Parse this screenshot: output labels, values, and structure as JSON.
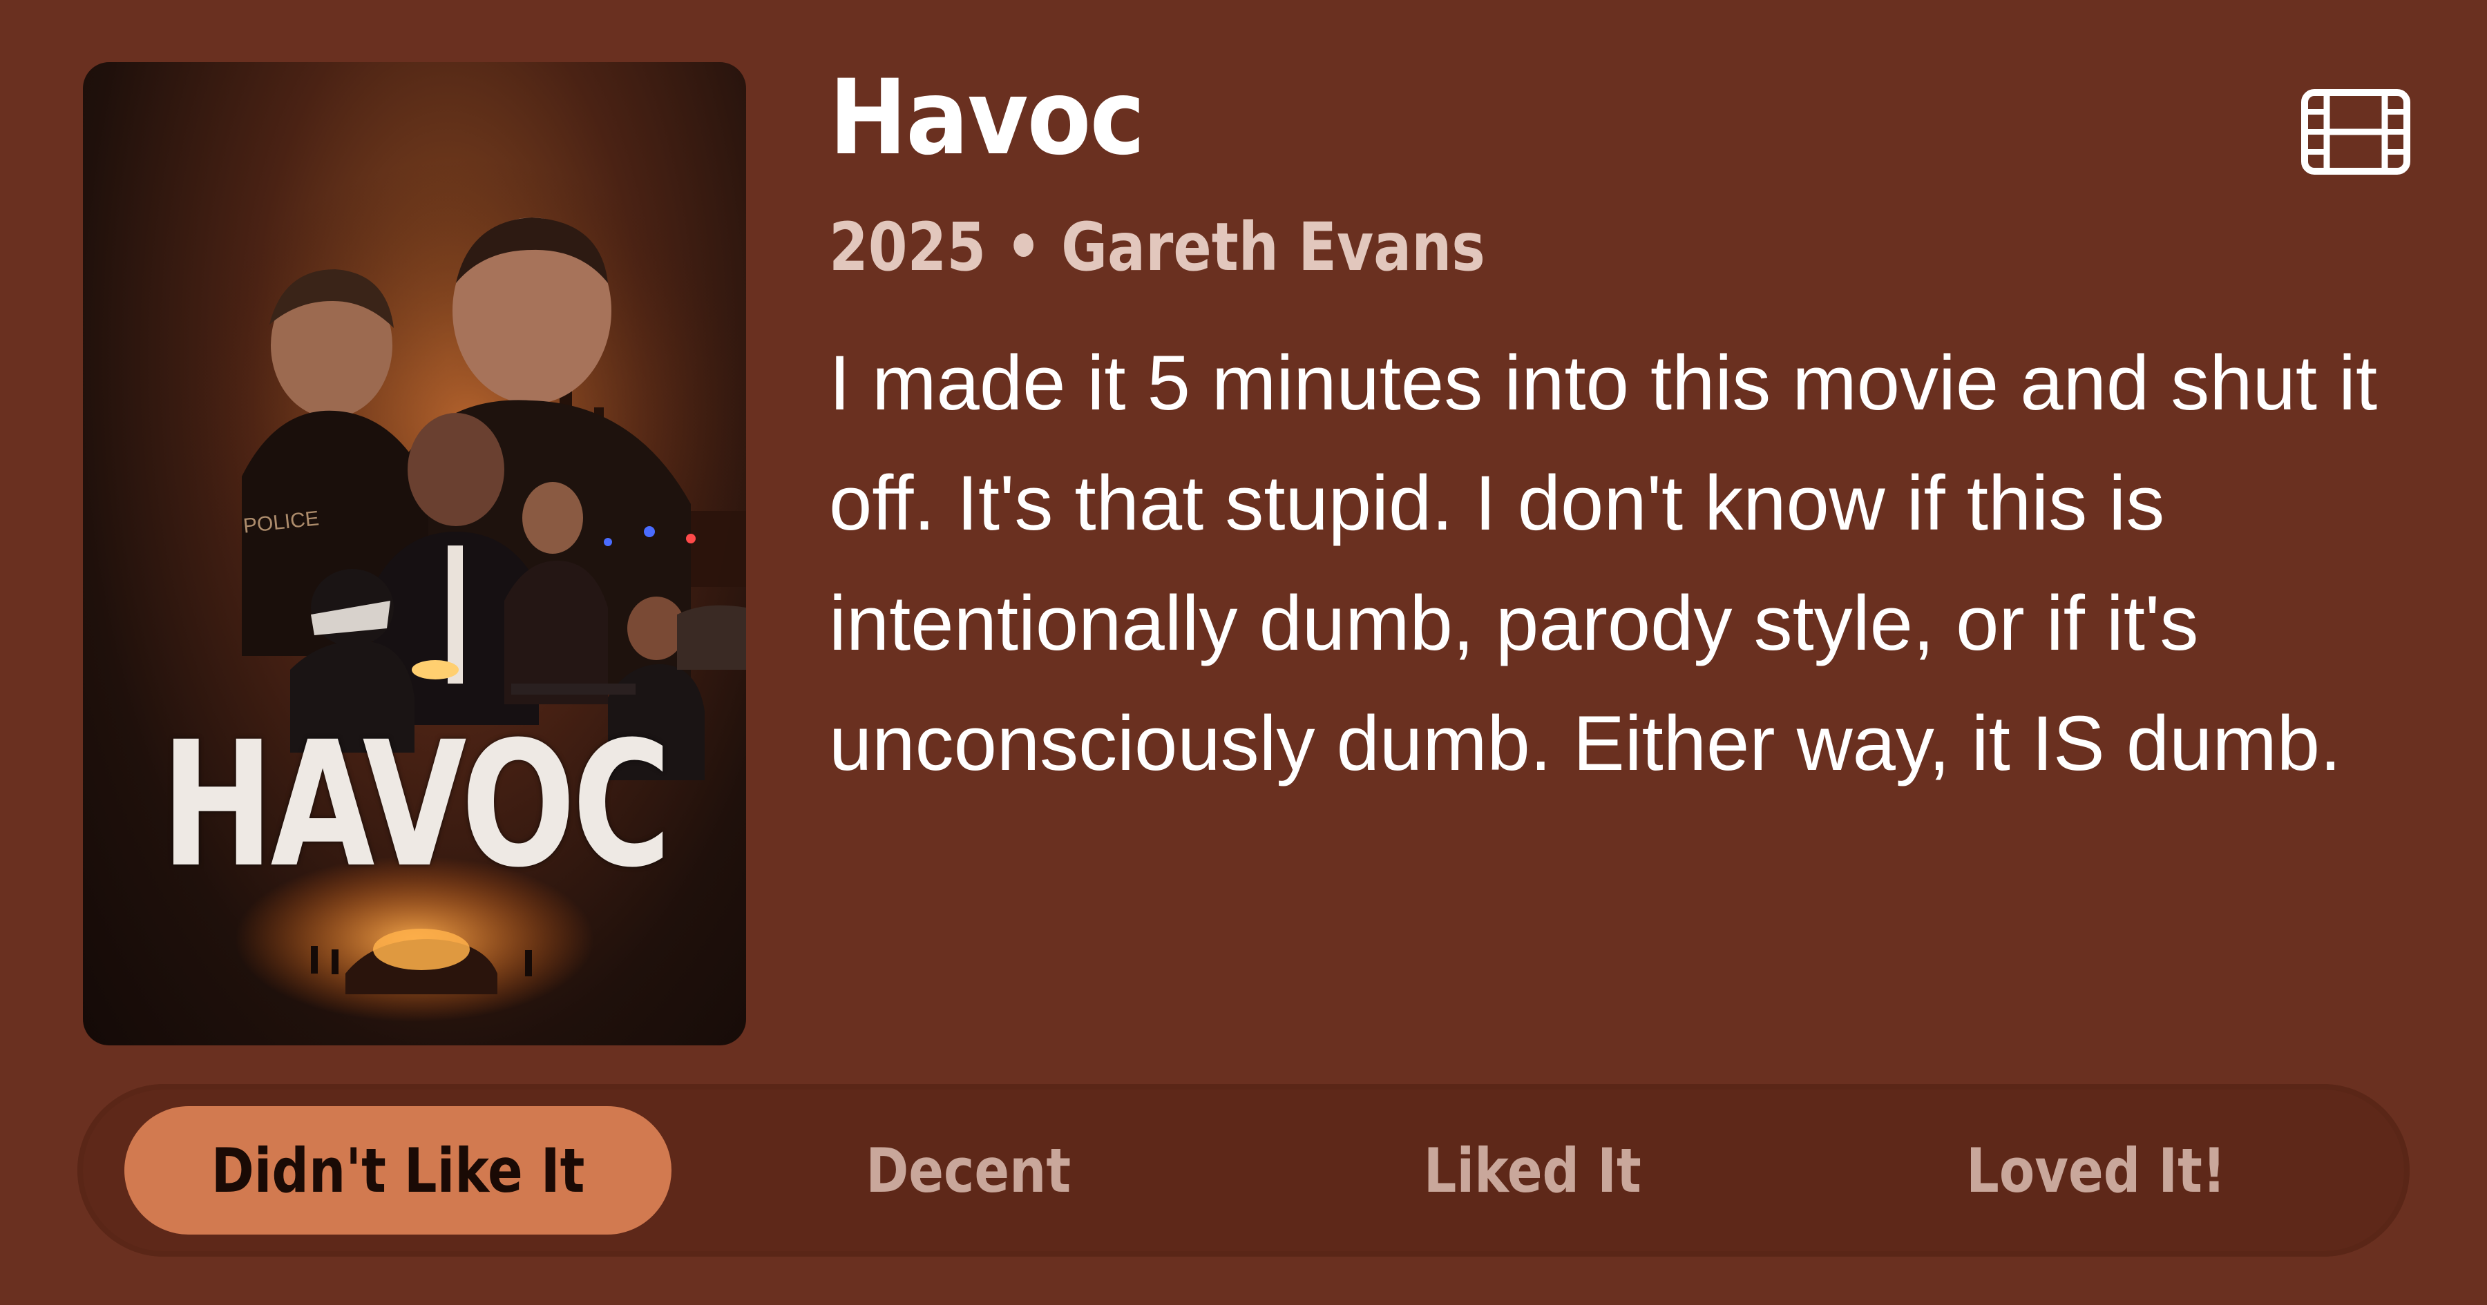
{
  "movie": {
    "title": "Havoc",
    "meta": "2025 • Gareth Evans",
    "review": "I made it 5 minutes into this movie and shut it off. It's that stupid. I don't know if this is intentionally dumb, parody style, or if it's unconsciously dumb. Either way, it IS dumb.",
    "poster": {
      "title_text": "HAVOC",
      "badge_text": "POLICE"
    }
  },
  "icons": {
    "media_type": "film-icon"
  },
  "rating": {
    "options": [
      {
        "label": "Didn't Like It",
        "selected": true
      },
      {
        "label": "Decent",
        "selected": false
      },
      {
        "label": "Liked It",
        "selected": false
      },
      {
        "label": "Loved It!",
        "selected": false
      }
    ]
  },
  "colors": {
    "background": "#6a3020",
    "accent": "#d27a50",
    "subtitle": "#e2c7bd",
    "muted_option": "#c9a79b"
  }
}
